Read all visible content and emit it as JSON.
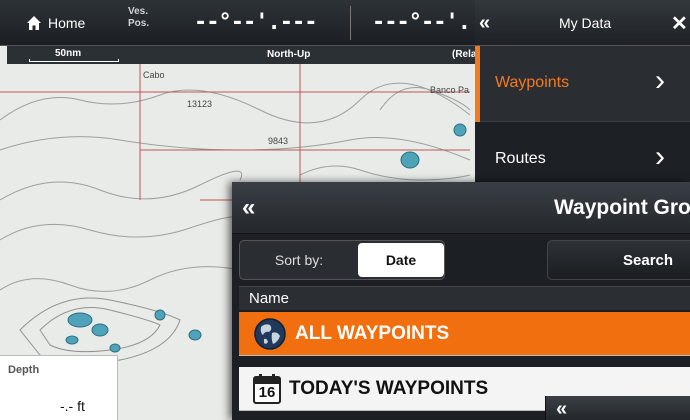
{
  "chart": {
    "depths": [
      "13123",
      "9843"
    ],
    "place_names": [
      "Cabo",
      "Banco Pa"
    ]
  },
  "topbar": {
    "home_label": "Home",
    "vessel_label": "Ves.",
    "position_label": "Pos.",
    "readout_left": "--°--'.---",
    "readout_right": "---°--'.",
    "scale": "50nm",
    "orientation": "North-Up",
    "motion": "(Relat"
  },
  "depth_widget": {
    "title": "Depth",
    "value": "-.- ft"
  },
  "my_data": {
    "title": "My Data",
    "back_glyph": "«",
    "close_glyph": "✕",
    "items": [
      {
        "label": "Waypoints",
        "selected": true
      },
      {
        "label": "Routes",
        "selected": false
      }
    ]
  },
  "waypoint_group": {
    "title": "Waypoint Gro",
    "sort_label": "Sort by:",
    "sort_value": "Date",
    "search_label": "Search",
    "column_name": "Name",
    "rows": [
      {
        "label": "ALL WAYPOINTS",
        "icon": "globe-icon",
        "selected": true
      },
      {
        "label": "TODAY'S WAYPOINTS",
        "icon": "calendar-icon",
        "calendar_day": "16",
        "selected": false
      }
    ]
  },
  "colors": {
    "accent": "#f26f0f",
    "panel_dark": "#1c2024",
    "chart_bg": "#e9ebe9"
  }
}
